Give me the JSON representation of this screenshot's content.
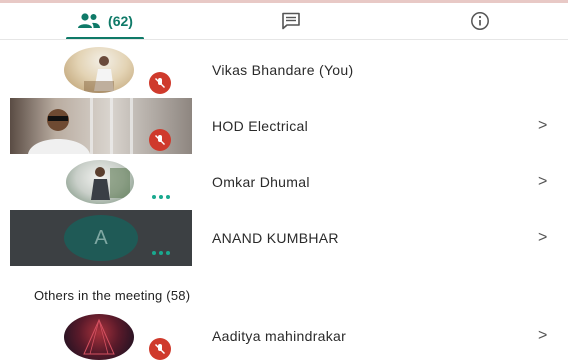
{
  "tabs": {
    "people": {
      "icon": "people-icon",
      "count": "(62)",
      "active": true
    },
    "chat": {
      "icon": "chat-icon"
    },
    "info": {
      "icon": "info-icon"
    }
  },
  "participants": [
    {
      "name": "Vikas Bhandare (You)",
      "status": "muted"
    },
    {
      "name": "HOD Electrical",
      "status": "muted",
      "chevron": ">"
    },
    {
      "name": "Omkar Dhumal",
      "status": "more",
      "chevron": ">"
    },
    {
      "name": "ANAND KUMBHAR",
      "initial": "A",
      "status": "more",
      "chevron": ">"
    }
  ],
  "others": {
    "header": "Others in the meeting (58)",
    "items": [
      {
        "name": "Aaditya mahindrakar",
        "status": "muted",
        "chevron": ">"
      }
    ]
  },
  "colors": {
    "accent": "#0f7a68",
    "mute": "#cf3a2c",
    "dark_tile": "#3c4043"
  }
}
